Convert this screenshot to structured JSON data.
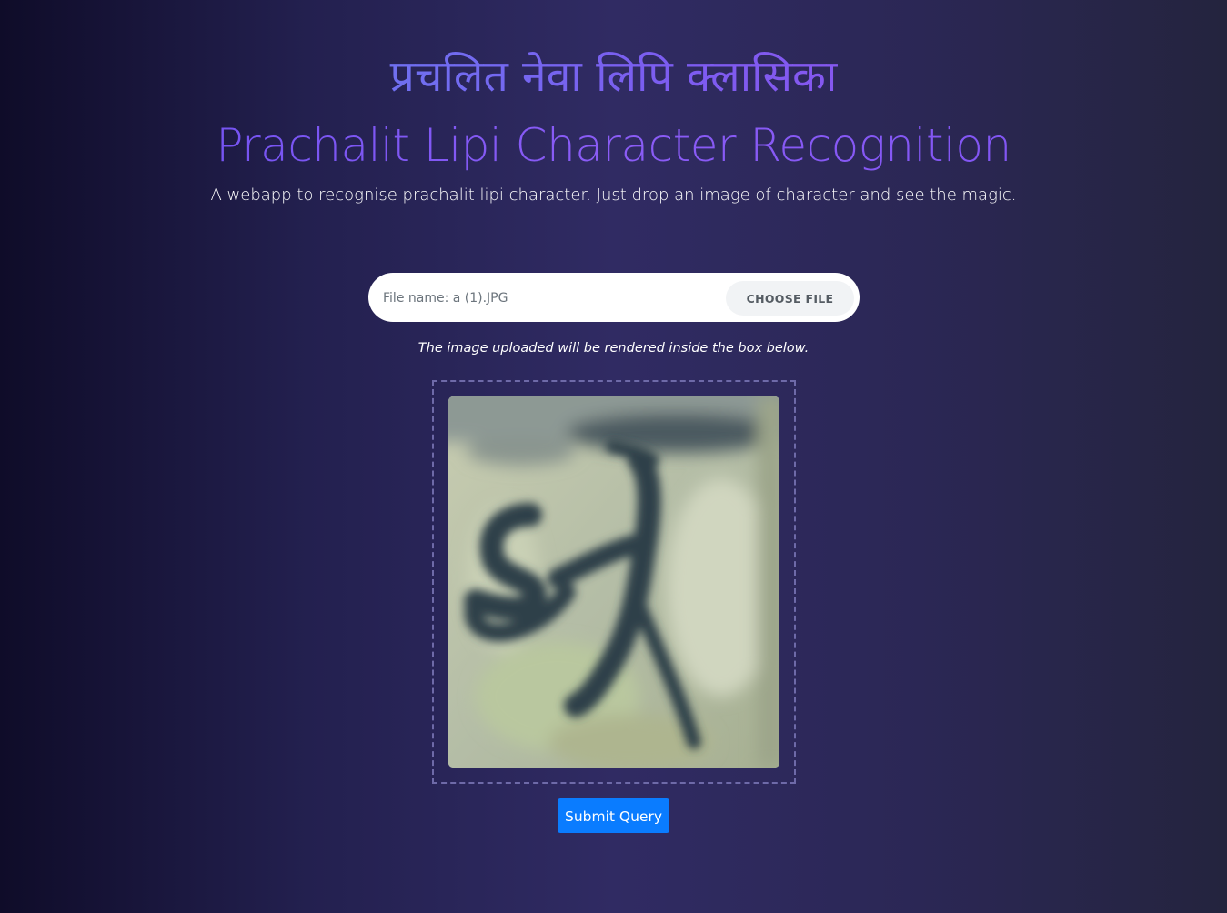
{
  "header": {
    "title_native": "प्रचलित नेवा लिपि क्लासिका",
    "title_english": "Prachalit Lipi Character Recognition",
    "subtitle": "A webapp to recognise prachalit lipi character. Just drop an image of character and see the magic."
  },
  "upload": {
    "file_name_text": "File name: a (1).JPG",
    "choose_file_label": "CHOOSE FILE",
    "hint": "The image uploaded will be rendered inside the box below."
  },
  "preview": {
    "image_icon": "uploaded-character-image"
  },
  "actions": {
    "submit_label": "Submit Query"
  },
  "colors": {
    "submit_button": "#0a7cff",
    "title_gradient_start": "#6a4ff0",
    "title_gradient_end": "#9b4df0",
    "background_dark": "#0f0c29",
    "background_mid": "#302b63"
  }
}
